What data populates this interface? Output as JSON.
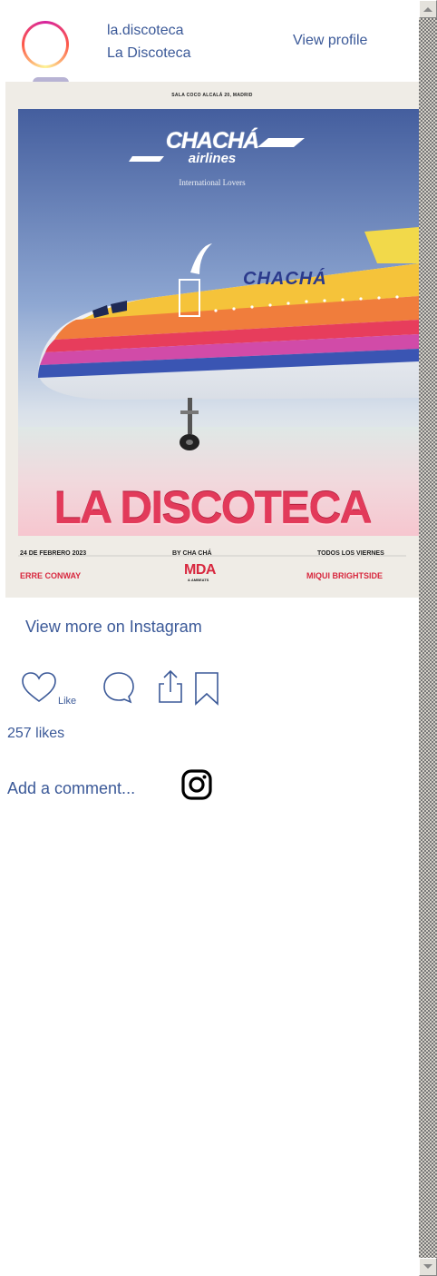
{
  "header": {
    "username": "la.discoteca",
    "full_name": "La Discoteca",
    "view_profile": "View profile"
  },
  "poster": {
    "venue": "SALA COCO ALCALÁ 20, MADRID",
    "airline_line1": "CHACHÁ",
    "airline_line2": "airlines",
    "subtitle": "International Lovers",
    "plane_text": "CHACHÁ",
    "title": "LA DISCOTECA",
    "date": "24 DE FEBRERO 2023",
    "by": "BY CHA CHÁ",
    "schedule": "TODOS LOS VIERNES",
    "dj_left": "ERRE CONWAY",
    "dj_center": "MDA",
    "dj_center_sub": "& AMBEATS",
    "dj_right": "MIQUI BRIGHTSIDE"
  },
  "footer": {
    "view_more": "View more on Instagram",
    "like_label": "Like",
    "likes": "257 likes",
    "add_comment": "Add a comment..."
  },
  "icons": [
    "heart-icon",
    "comment-icon",
    "share-icon",
    "bookmark-icon",
    "instagram-icon",
    "scroll-up-arrow-icon",
    "scroll-down-arrow-icon"
  ],
  "colors": {
    "link": "#3b5998",
    "title_pink": "#e23a5a"
  }
}
